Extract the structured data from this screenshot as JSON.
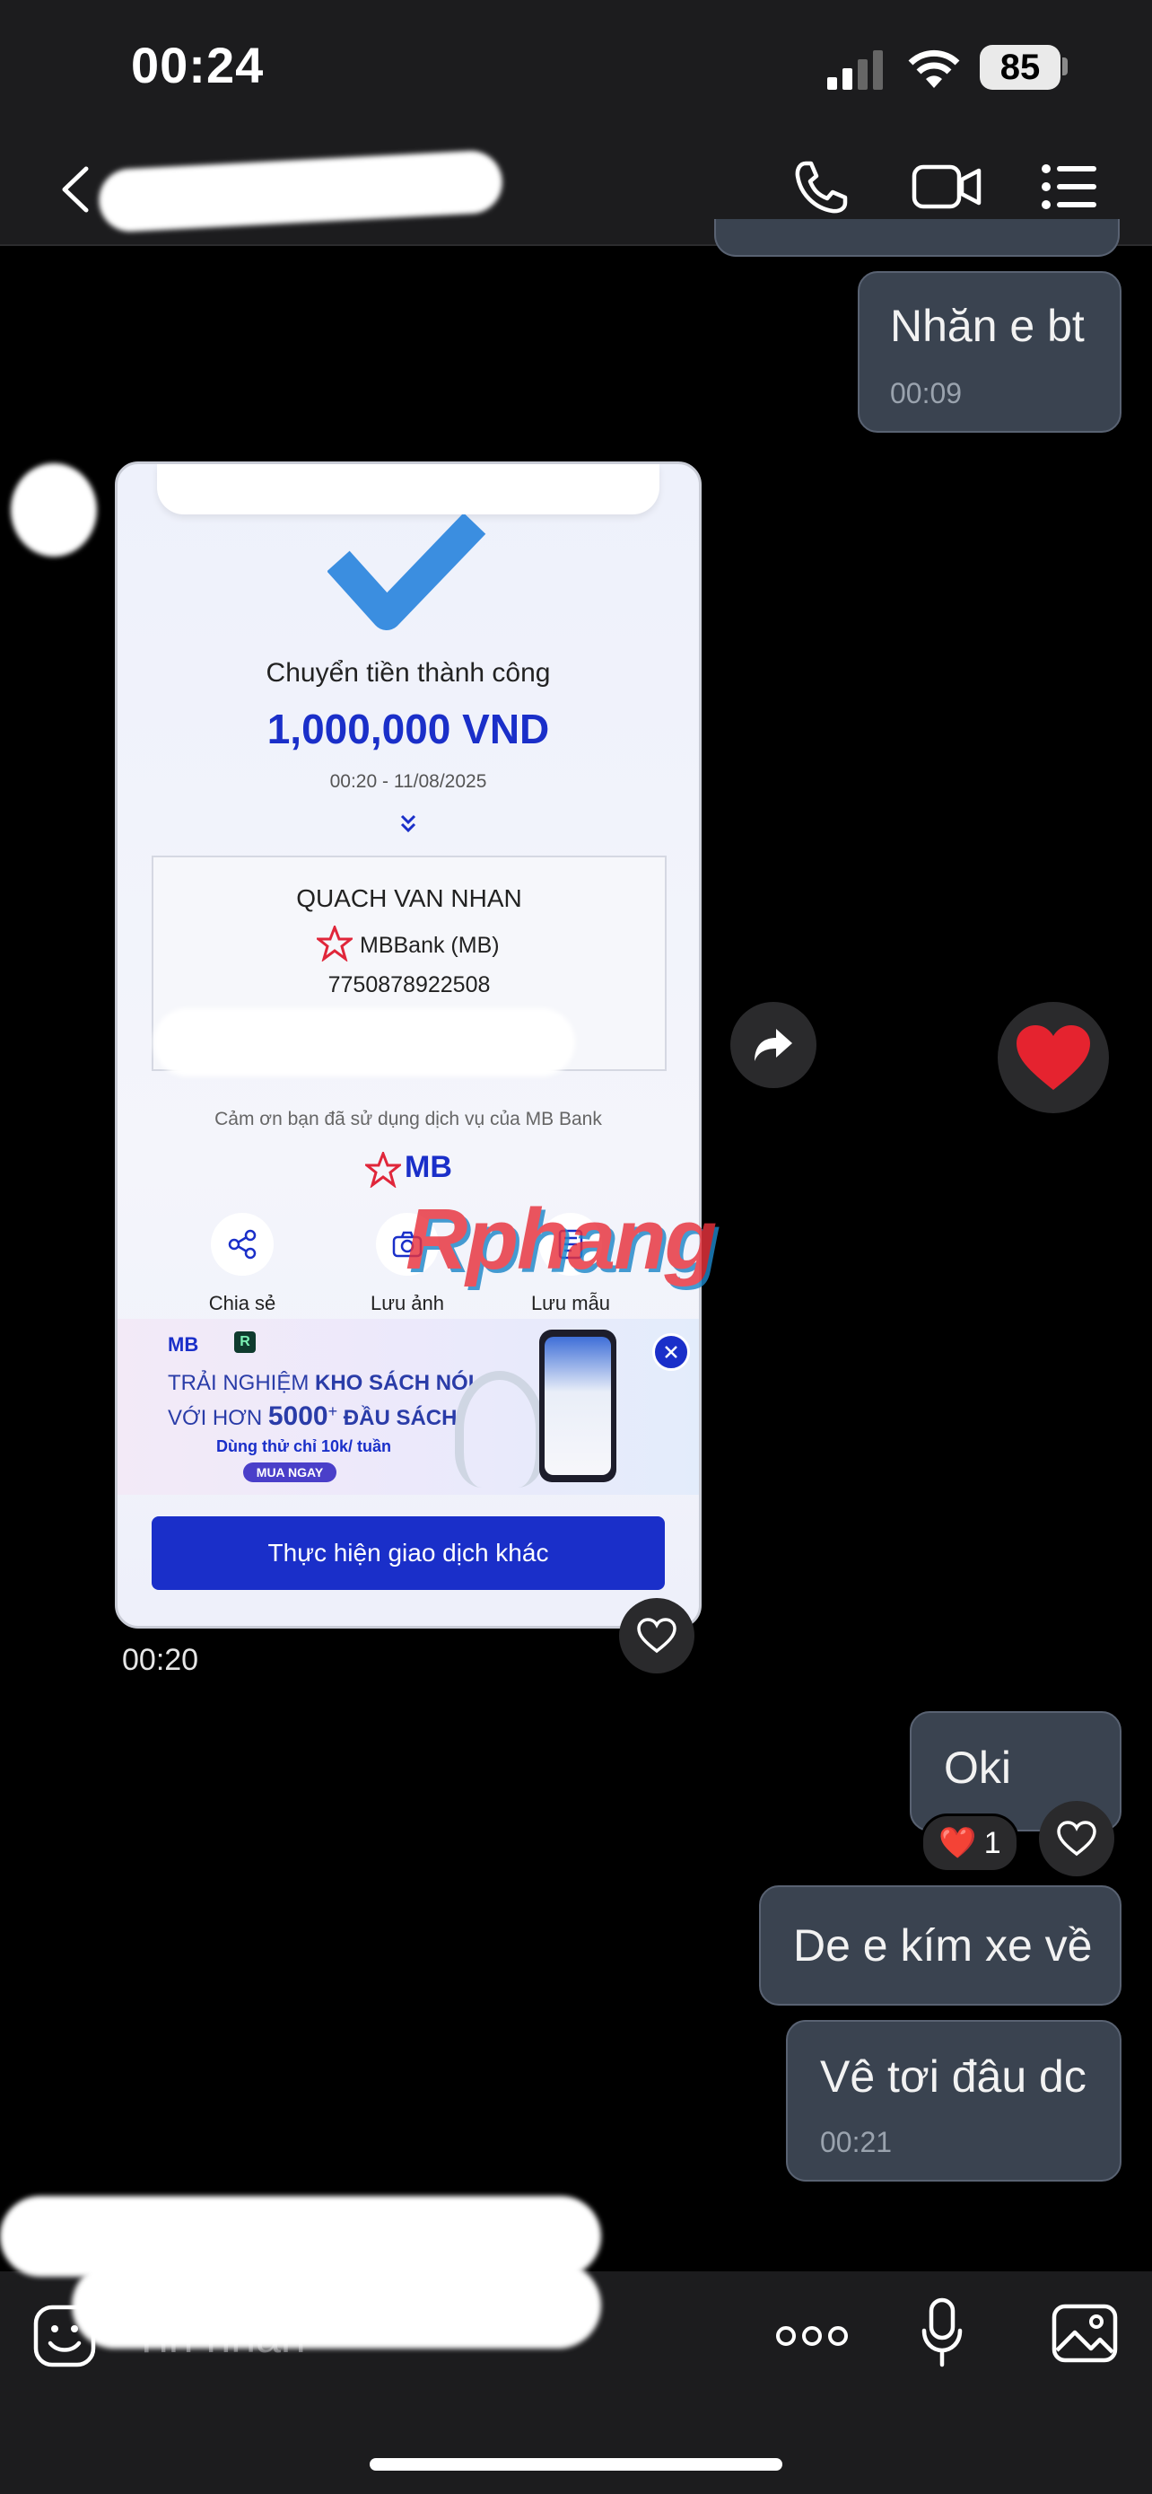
{
  "status_bar": {
    "time": "00:24",
    "battery": "85"
  },
  "messages": {
    "m1": {
      "text": "Nhăn e bt",
      "time": "00:09"
    },
    "image_time": "00:20",
    "m2": {
      "text": "Oki",
      "reaction_emoji": "❤️",
      "reaction_count": "1"
    },
    "m3": {
      "text": "De e kím xe về"
    },
    "m4": {
      "text": "Vê tơi đâu dc",
      "time": "00:21"
    }
  },
  "receipt": {
    "title": "Chuyển tiền thành công",
    "amount": "1,000,000 VND",
    "datetime": "00:20 - 11/08/2025",
    "recipient_name": "QUACH VAN NHAN",
    "bank": "MBBank (MB)",
    "account_number": "7750878922508",
    "thanks": "Cảm ơn bạn đã sử dụng dịch vụ của MB Bank",
    "brand": "MB",
    "actions": [
      "Chia sẻ",
      "Lưu ảnh",
      "Lưu mẫu"
    ],
    "banner": {
      "logo": "MB",
      "line1_prefix": "TRẢI NGHIỆM ",
      "line1_bold": "KHO SÁCH NÓI",
      "line2_prefix": "VỚI HƠN ",
      "line2_number": "5000",
      "line2_plus": "+",
      "line2_bold": " ĐẦU SÁCH",
      "line3": "Dùng thử chỉ 10k/ tuần",
      "cta": "MUA NGAY"
    },
    "primary_button": "Thực hiện giao dịch khác"
  },
  "watermark": "Rphang",
  "input": {
    "placeholder": "Tin nhắn"
  },
  "colors": {
    "bubble_out": "#3a4350",
    "receipt_blue": "#1a2fc9",
    "mb_red": "#e0263a"
  }
}
